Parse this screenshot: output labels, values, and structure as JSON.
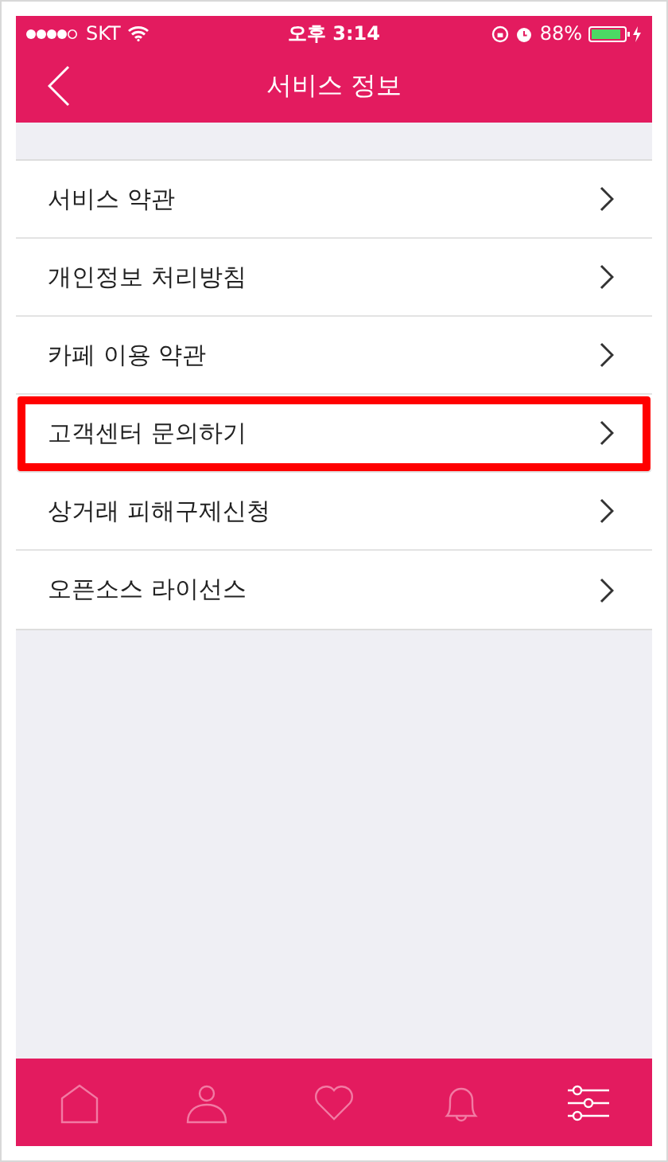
{
  "status_bar": {
    "carrier": "SKT",
    "time": "오후 3:14",
    "battery": "88%"
  },
  "nav": {
    "title": "서비스 정보"
  },
  "menu": [
    {
      "label": "서비스 약관",
      "highlighted": false
    },
    {
      "label": "개인정보 처리방침",
      "highlighted": false
    },
    {
      "label": "카페 이용 약관",
      "highlighted": false
    },
    {
      "label": "고객센터 문의하기",
      "highlighted": true
    },
    {
      "label": "상거래 피해구제신청",
      "highlighted": false
    },
    {
      "label": "오픈소스 라이선스",
      "highlighted": false
    }
  ],
  "tabs": [
    {
      "kind": "home",
      "selected": false
    },
    {
      "kind": "profile",
      "selected": false
    },
    {
      "kind": "heart",
      "selected": false
    },
    {
      "kind": "bell",
      "selected": false
    },
    {
      "kind": "settings",
      "selected": true
    }
  ]
}
